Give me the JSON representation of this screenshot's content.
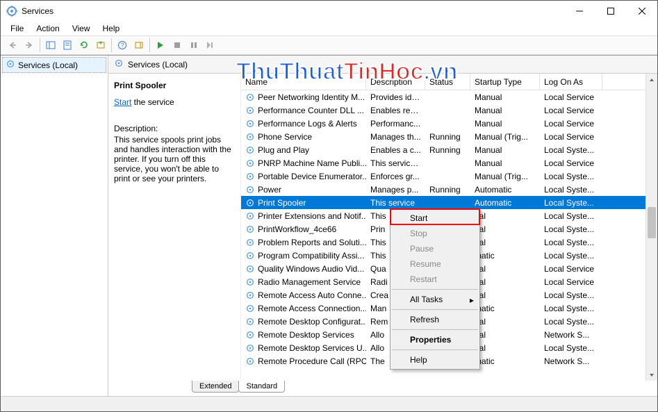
{
  "window": {
    "title": "Services"
  },
  "menu": {
    "file": "File",
    "action": "Action",
    "view": "View",
    "help": "Help"
  },
  "tree": {
    "root": "Services (Local)"
  },
  "panel": {
    "header": "Services (Local)",
    "selected_name": "Print Spooler",
    "start_link": "Start",
    "start_suffix": " the service",
    "desc_label": "Description:",
    "desc_text": "This service spools print jobs and handles interaction with the printer. If you turn off this service, you won't be able to print or see your printers."
  },
  "columns": {
    "name": "Name",
    "desc": "Description",
    "status": "Status",
    "startup": "Startup Type",
    "logon": "Log On As"
  },
  "rows": [
    {
      "name": "Peer Networking Identity M...",
      "desc": "Provides ide...",
      "status": "",
      "startup": "Manual",
      "logon": "Local Service"
    },
    {
      "name": "Performance Counter DLL ...",
      "desc": "Enables rem...",
      "status": "",
      "startup": "Manual",
      "logon": "Local Service"
    },
    {
      "name": "Performance Logs & Alerts",
      "desc": "Performanc...",
      "status": "",
      "startup": "Manual",
      "logon": "Local Service"
    },
    {
      "name": "Phone Service",
      "desc": "Manages th...",
      "status": "Running",
      "startup": "Manual (Trig...",
      "logon": "Local Service"
    },
    {
      "name": "Plug and Play",
      "desc": "Enables a c...",
      "status": "Running",
      "startup": "Manual",
      "logon": "Local Syste..."
    },
    {
      "name": "PNRP Machine Name Publi...",
      "desc": "This service ...",
      "status": "",
      "startup": "Manual",
      "logon": "Local Service"
    },
    {
      "name": "Portable Device Enumerator...",
      "desc": "Enforces gr...",
      "status": "",
      "startup": "Manual (Trig...",
      "logon": "Local Syste..."
    },
    {
      "name": "Power",
      "desc": "Manages p...",
      "status": "Running",
      "startup": "Automatic",
      "logon": "Local Syste..."
    },
    {
      "name": "Print Spooler",
      "desc": "This service",
      "status": "",
      "startup": "Automatic",
      "logon": "Local Syste...",
      "selected": true
    },
    {
      "name": "Printer Extensions and Notif...",
      "desc": "This",
      "status": "",
      "startup": "ual",
      "logon": "Local Syste..."
    },
    {
      "name": "PrintWorkflow_4ce66",
      "desc": "Prin",
      "status": "",
      "startup": "ual",
      "logon": "Local Syste..."
    },
    {
      "name": "Problem Reports and Soluti...",
      "desc": "This",
      "status": "",
      "startup": "ual",
      "logon": "Local Syste..."
    },
    {
      "name": "Program Compatibility Assi...",
      "desc": "This",
      "status": "",
      "startup": "matic",
      "logon": "Local Syste..."
    },
    {
      "name": "Quality Windows Audio Vid...",
      "desc": "Qua",
      "status": "",
      "startup": "ual",
      "logon": "Local Service"
    },
    {
      "name": "Radio Management Service",
      "desc": "Radi",
      "status": "",
      "startup": "ual",
      "logon": "Local Service"
    },
    {
      "name": "Remote Access Auto Conne...",
      "desc": "Crea",
      "status": "",
      "startup": "ual",
      "logon": "Local Syste..."
    },
    {
      "name": "Remote Access Connection...",
      "desc": "Man",
      "status": "",
      "startup": "matic",
      "logon": "Local Syste..."
    },
    {
      "name": "Remote Desktop Configurat...",
      "desc": "Rem",
      "status": "",
      "startup": "ual",
      "logon": "Local Syste..."
    },
    {
      "name": "Remote Desktop Services",
      "desc": "Allo",
      "status": "",
      "startup": "ual",
      "logon": "Network S..."
    },
    {
      "name": "Remote Desktop Services U...",
      "desc": "Allo",
      "status": "",
      "startup": "ual",
      "logon": "Local Syste..."
    },
    {
      "name": "Remote Procedure Call (RPC)",
      "desc": "The",
      "status": "",
      "startup": "matic",
      "logon": "Network S..."
    }
  ],
  "context_menu": {
    "start": "Start",
    "stop": "Stop",
    "pause": "Pause",
    "resume": "Resume",
    "restart": "Restart",
    "all_tasks": "All Tasks",
    "refresh": "Refresh",
    "properties": "Properties",
    "help": "Help"
  },
  "tabs": {
    "extended": "Extended",
    "standard": "Standard"
  },
  "watermark": {
    "t1": "ThuThuat",
    "t2": "TinHoc",
    "t3": ".vn"
  }
}
